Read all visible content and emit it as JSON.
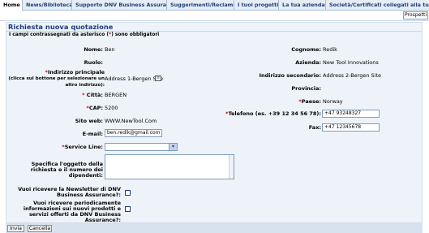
{
  "tabs": [
    {
      "label": "Home",
      "active": true
    },
    {
      "label": "News/Biblioteca"
    },
    {
      "label": "Supporto DNV Business Assurance"
    },
    {
      "label": "Suggerimenti/Reclami"
    },
    {
      "label": "I tuoi progetti"
    },
    {
      "label": "La tua azienda"
    },
    {
      "label": "Società/Certificati collegati alla tua a"
    }
  ],
  "subbar": {
    "prospects_label": "Prospetti"
  },
  "page": {
    "title": "Richiesta nuova quotazione",
    "required_note_before": "I campi contrassegnati da asterisco (",
    "required_mark": "*",
    "required_note_after": ") sono obbligatori"
  },
  "form": {
    "asterisk": "*",
    "nome_label": "Nome:",
    "nome_value": "Ben",
    "cognome_label": "Cognome:",
    "cognome_value": "Redik",
    "ruolo_label": "Ruolo:",
    "azienda_label": "Azienda:",
    "azienda_value": "New Tool Innovations",
    "indirizzo_label": "Indirizzo principale",
    "indirizzo_hint": "(clicca sul bottone per selezionare un altro indirizzo):",
    "indirizzo_value": "Address 1-Bergen Site",
    "indirizzo2_label": "Indirizzo secondario:",
    "indirizzo2_value": "Address 2-Bergen Site",
    "provincia_label": "Provincia:",
    "citta_label": "Città:",
    "citta_value": "BERGEN",
    "paese_label": "Paese:",
    "paese_value": "Norway",
    "cap_label": "CAP:",
    "cap_value": "5200",
    "telefono_label": "Telefono (es. +39 12 34 56 78):",
    "telefono_value": "+47 93248327",
    "sito_label": "Sito web:",
    "sito_value": "WWW.NewTool.Com",
    "fax_label": "Fax:",
    "fax_value": "+47 12345678",
    "email_label": "E-mail:",
    "email_value": "ben.redik@gmail.com",
    "service_line_label": "Service Line:",
    "service_line_value": "",
    "oggetto_label": "Specifica l'oggetto della richiesta e il numero dei dipendenti:",
    "newsletter_label": "Vuoi ricevere la Newsletter di DNV Business Assurance?:",
    "info_label": "Vuoi ricevere periodicamente informazioni sui nuovi prodotti e servizi offerti da DNV Business Assurance?:"
  },
  "buttons": {
    "submit": "Invia",
    "cancel": "Cancella"
  },
  "colors": {
    "title": "#1d3c78",
    "required": "#cc0000",
    "panel": "#eef3fa"
  }
}
